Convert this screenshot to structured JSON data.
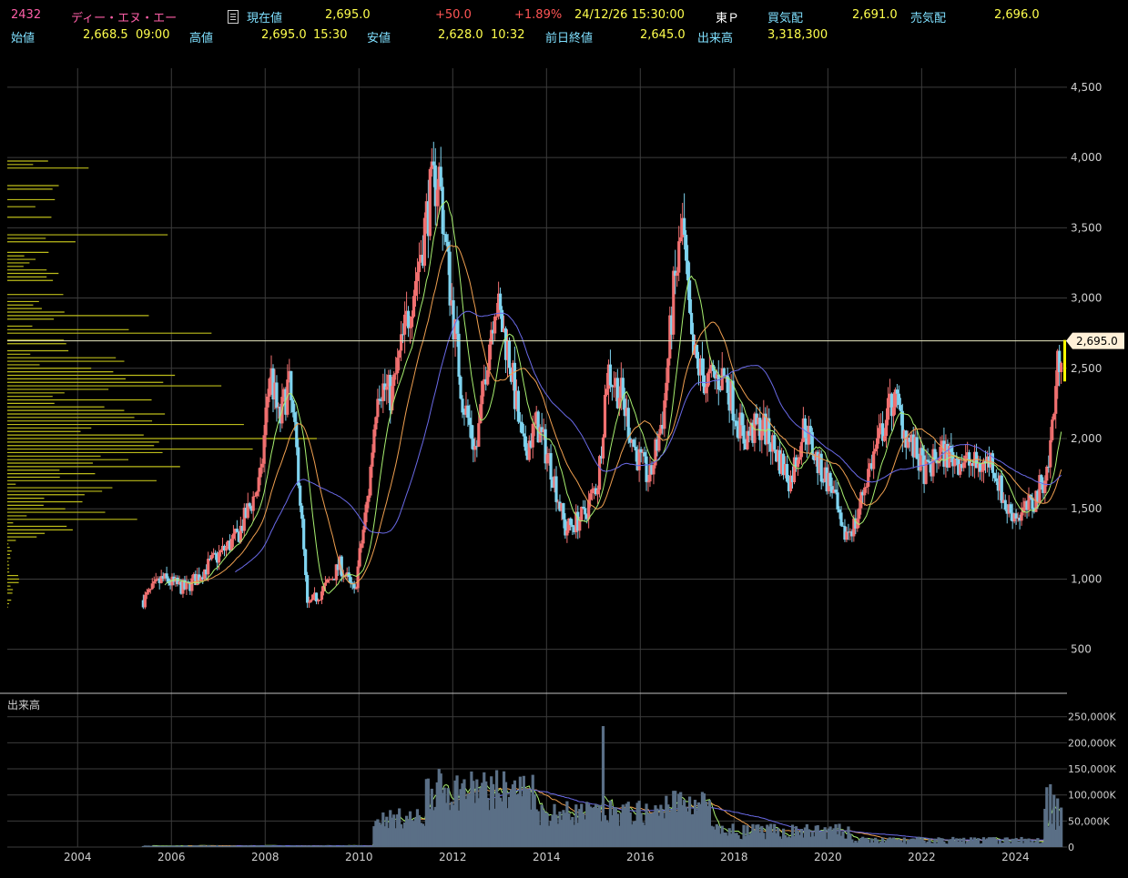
{
  "header": {
    "code": "2432",
    "name": "ディー・エヌ・エー",
    "current_label": "現在値",
    "current_value": "2,695.0",
    "change": "+50.0",
    "change_pct": "+1.89%",
    "datetime": "24/12/26  15:30:00",
    "market": "東Ｐ",
    "bid_label": "買気配",
    "bid_value": "2,691.0",
    "ask_label": "売気配",
    "ask_value": "2,696.0",
    "open_label": "始値",
    "open_value": "2,668.5",
    "open_time": "09:00",
    "high_label": "高値",
    "high_value": "2,695.0",
    "high_time": "15:30",
    "low_label": "安値",
    "low_value": "2,628.0",
    "low_time": "10:32",
    "prev_close_label": "前日終値",
    "prev_close_value": "2,645.0",
    "volume_label": "出来高",
    "volume_value": "3,318,300"
  },
  "colors": {
    "up_candle": "#f07070",
    "down_candle": "#7fd4f0",
    "ma_short": "#a8f070",
    "ma_mid": "#f0a050",
    "ma_long": "#6a6ae8",
    "volume_bar": "#5a6f86",
    "profile": "#bcbc1a",
    "grid": "#3c3c3c",
    "price_line": "#e8e8c0",
    "price_tag": "#fff0d8"
  },
  "chart_data": {
    "type": "candlestick",
    "x_tick_labels": [
      "2004",
      "2006",
      "2008",
      "2010",
      "2012",
      "2014",
      "2016",
      "2018",
      "2020",
      "2022",
      "2024"
    ],
    "y_ticks": [
      "4,500",
      "4,000",
      "3,500",
      "3,000",
      "2,500",
      "2,000",
      "1,500",
      "1,000",
      "500"
    ],
    "ylim": [
      200,
      4700
    ],
    "current_price_label": "2,695.0",
    "current_price": 2695,
    "volume_panel_label": "出来高",
    "volume_ticks": [
      "250,000K",
      "200,000K",
      "150,000K",
      "100,000K",
      "50,000K",
      "0"
    ],
    "volume_ylim": [
      0,
      260000
    ],
    "price_anchors": [
      {
        "t": 2005.4,
        "p": 850
      },
      {
        "t": 2005.8,
        "p": 1000
      },
      {
        "t": 2006.3,
        "p": 930
      },
      {
        "t": 2006.8,
        "p": 1100
      },
      {
        "t": 2007.4,
        "p": 1300
      },
      {
        "t": 2007.9,
        "p": 1700
      },
      {
        "t": 2008.1,
        "p": 2500
      },
      {
        "t": 2008.3,
        "p": 2100
      },
      {
        "t": 2008.5,
        "p": 2400
      },
      {
        "t": 2008.7,
        "p": 1800
      },
      {
        "t": 2008.9,
        "p": 800
      },
      {
        "t": 2009.3,
        "p": 950
      },
      {
        "t": 2009.6,
        "p": 1100
      },
      {
        "t": 2009.9,
        "p": 900
      },
      {
        "t": 2010.2,
        "p": 1600
      },
      {
        "t": 2010.4,
        "p": 2400
      },
      {
        "t": 2010.7,
        "p": 2300
      },
      {
        "t": 2011.0,
        "p": 2800
      },
      {
        "t": 2011.3,
        "p": 3300
      },
      {
        "t": 2011.5,
        "p": 3700
      },
      {
        "t": 2011.7,
        "p": 3900
      },
      {
        "t": 2011.9,
        "p": 3200
      },
      {
        "t": 2012.2,
        "p": 2300
      },
      {
        "t": 2012.5,
        "p": 1900
      },
      {
        "t": 2012.7,
        "p": 2500
      },
      {
        "t": 2012.9,
        "p": 3000
      },
      {
        "t": 2013.2,
        "p": 2600
      },
      {
        "t": 2013.5,
        "p": 1900
      },
      {
        "t": 2013.8,
        "p": 2100
      },
      {
        "t": 2014.1,
        "p": 1800
      },
      {
        "t": 2014.4,
        "p": 1350
      },
      {
        "t": 2014.8,
        "p": 1450
      },
      {
        "t": 2015.1,
        "p": 1700
      },
      {
        "t": 2015.3,
        "p": 2500
      },
      {
        "t": 2015.6,
        "p": 2300
      },
      {
        "t": 2015.9,
        "p": 1900
      },
      {
        "t": 2016.2,
        "p": 1700
      },
      {
        "t": 2016.5,
        "p": 2200
      },
      {
        "t": 2016.7,
        "p": 3000
      },
      {
        "t": 2016.9,
        "p": 3500
      },
      {
        "t": 2017.1,
        "p": 2600
      },
      {
        "t": 2017.4,
        "p": 2400
      },
      {
        "t": 2017.8,
        "p": 2450
      },
      {
        "t": 2018.2,
        "p": 2000
      },
      {
        "t": 2018.6,
        "p": 2100
      },
      {
        "t": 2018.9,
        "p": 1900
      },
      {
        "t": 2019.2,
        "p": 1700
      },
      {
        "t": 2019.5,
        "p": 2100
      },
      {
        "t": 2019.8,
        "p": 1800
      },
      {
        "t": 2020.1,
        "p": 1650
      },
      {
        "t": 2020.3,
        "p": 1300
      },
      {
        "t": 2020.6,
        "p": 1400
      },
      {
        "t": 2020.8,
        "p": 1700
      },
      {
        "t": 2021.1,
        "p": 2000
      },
      {
        "t": 2021.4,
        "p": 2300
      },
      {
        "t": 2021.7,
        "p": 2000
      },
      {
        "t": 2022.1,
        "p": 1750
      },
      {
        "t": 2022.4,
        "p": 1900
      },
      {
        "t": 2022.8,
        "p": 1850
      },
      {
        "t": 2023.2,
        "p": 1800
      },
      {
        "t": 2023.5,
        "p": 1850
      },
      {
        "t": 2023.8,
        "p": 1500
      },
      {
        "t": 2024.1,
        "p": 1450
      },
      {
        "t": 2024.4,
        "p": 1550
      },
      {
        "t": 2024.7,
        "p": 1800
      },
      {
        "t": 2024.9,
        "p": 2500
      },
      {
        "t": 2024.98,
        "p": 2695
      }
    ]
  }
}
